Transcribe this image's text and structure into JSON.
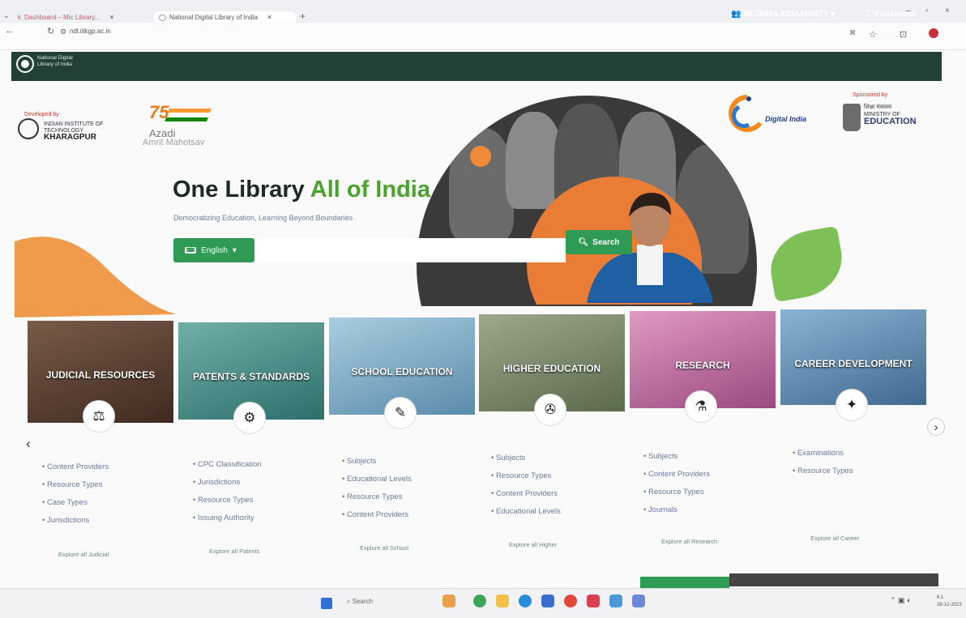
{
  "browser": {
    "tabs": [
      {
        "title": "Dashboard – Mic Library...",
        "active": false
      },
      {
        "title": "National Digital Library of India",
        "active": true
      }
    ],
    "url": "ndl.iitkgp.ac.in"
  },
  "topbar": {
    "site_name": "National Digital Library of India",
    "user": "RESHMA 229A1R0071",
    "fullscreen": "Fullscreen"
  },
  "header": {
    "developed_by": "Developed by",
    "iit_name": "INDIAN INSTITUTE OF TECHNOLOGY",
    "iit_city": "KHARAGPUR",
    "azadi_num": "75",
    "azadi_word": "Azadi",
    "azadi_sub": "Amrit Mahotsav",
    "digital_india": "Digital India",
    "sponsored_by": "Sponsored by",
    "moe_hindi": "शिक्षा मंत्रालय",
    "moe_ministry": "MINISTRY OF",
    "moe_education": "EDUCATION"
  },
  "hero": {
    "title_a": "One Library ",
    "title_b": "All of India",
    "subtitle": "Democratizing Education, Learning Beyond Boundaries",
    "language": "English",
    "search_button": "Search"
  },
  "categories": [
    {
      "title": "JUDICIAL RESOURCES",
      "icon": "scales-icon",
      "glyph": "⚖",
      "color": "#5b3a2a",
      "links": [
        "Content Providers",
        "Resource Types",
        "Case Types",
        "Jurisdictions"
      ],
      "view_all": "Explore all Judicial"
    },
    {
      "title": "PATENTS & STANDARDS",
      "icon": "patent-icon",
      "glyph": "⚙",
      "color": "#3f8a8a",
      "links": [
        "CPC Classification",
        "Jurisdictions",
        "Resource Types",
        "Issuing Authority"
      ],
      "view_all": "Explore all Patents"
    },
    {
      "title": "SCHOOL EDUCATION",
      "icon": "school-icon",
      "glyph": "✎",
      "color": "#6b9fb8",
      "links": [
        "Subjects",
        "Educational Levels",
        "Resource Types",
        "Content Providers"
      ],
      "view_all": "Explore all School"
    },
    {
      "title": "HIGHER EDUCATION",
      "icon": "graduation-icon",
      "glyph": "✇",
      "color": "#7a8a6a",
      "links": [
        "Subjects",
        "Resource Types",
        "Content Providers",
        "Educational Levels"
      ],
      "view_all": "Explore all Higher"
    },
    {
      "title": "RESEARCH",
      "icon": "research-icon",
      "glyph": "⚗",
      "color": "#b86a9a",
      "links": [
        "Subjects",
        "Content Providers",
        "Resource Types",
        "Journals"
      ],
      "view_all": "Explore all Research"
    },
    {
      "title": "CAREER DEVELOPMENT",
      "icon": "career-icon",
      "glyph": "✦",
      "color": "#4d7aa0",
      "links": [
        "Examinations",
        "Resource Types"
      ],
      "view_all": "Explore all Career"
    }
  ],
  "taskbar": {
    "search_label": "Search",
    "time": "6:1",
    "date": "28-12-2023"
  }
}
